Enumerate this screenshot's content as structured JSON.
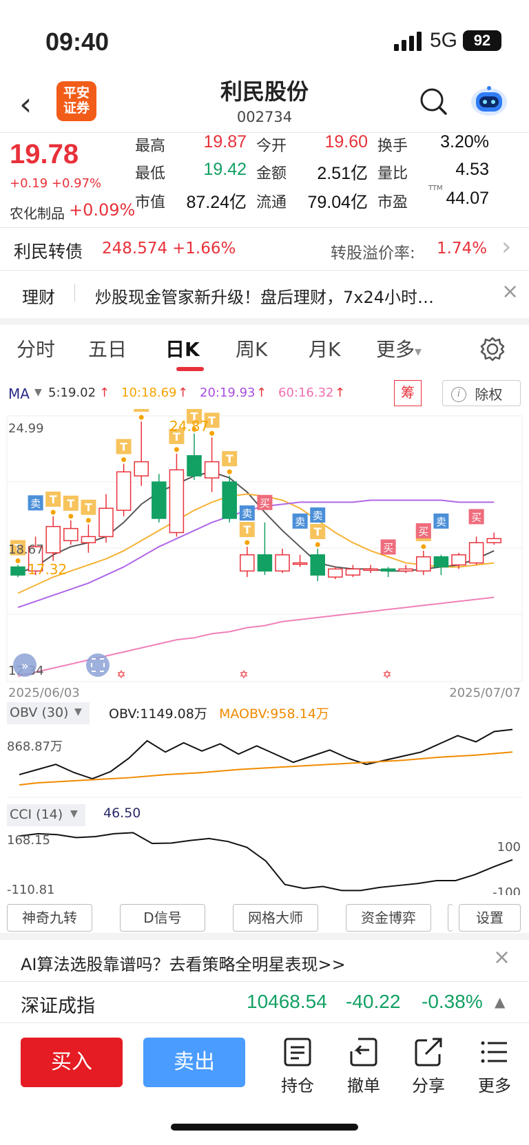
{
  "status_bar": {
    "time": "09:40",
    "network": "5G",
    "battery": "92"
  },
  "header": {
    "logo_line1": "平安",
    "logo_line2": "证券",
    "stock_name": "利民股份",
    "stock_code": "002734"
  },
  "quote": {
    "price": "19.78",
    "change": "+0.19 +0.97%",
    "sector_name": "农化制品",
    "sector_change": "+0.09%",
    "stats": [
      {
        "label": "最高",
        "value": "19.87",
        "color": "red"
      },
      {
        "label": "今开",
        "value": "19.60",
        "color": "red"
      },
      {
        "label": "换手",
        "value": "3.20%",
        "color": "black"
      },
      {
        "label": "最低",
        "value": "19.42",
        "color": "green"
      },
      {
        "label": "金额",
        "value": "2.51亿",
        "color": "black"
      },
      {
        "label": "量比",
        "value": "4.53",
        "color": "black"
      },
      {
        "label": "市值",
        "value": "87.24亿",
        "color": "black"
      },
      {
        "label": "流通",
        "value": "79.04亿",
        "color": "black"
      },
      {
        "label": "市盈",
        "value": "44.07",
        "color": "black",
        "sup": "TTM"
      }
    ]
  },
  "bond": {
    "name": "利民转债",
    "price": "248.574",
    "change": "+1.66%",
    "premium_label": "转股溢价率:",
    "premium_value": "1.74%"
  },
  "finance_banner": {
    "tag": "理财",
    "text": "炒股现金管家新升级！盘后理财，7x24小时…"
  },
  "tabs": [
    "分时",
    "五日",
    "日K",
    "周K",
    "月K",
    "更多"
  ],
  "active_tab": "日K",
  "ma_legend": {
    "label": "MA",
    "ma5": "5:19.02",
    "ma10": "10:18.69",
    "ma20": "20:19.93",
    "ma60": "60:16.32",
    "chips_button": "筹",
    "exright_button": "除权"
  },
  "colors": {
    "up": "#e8313a",
    "down": "#12a063",
    "ma5": "#555555",
    "ma10": "#f5b335",
    "ma20": "#b066e6",
    "ma60": "#f080b8"
  },
  "chart_data": [
    {
      "type": "candlestick",
      "title": "日K",
      "y_axis_labels": {
        "max": "24.99",
        "mid": "18.67",
        "min": "12.34"
      },
      "x_axis_labels": {
        "start": "2025/06/03",
        "end": "2025/07/07"
      },
      "annotations": {
        "high_label": "24.87",
        "low_label": "17.32"
      },
      "candles": [
        {
          "o": 17.8,
          "c": 17.4,
          "h": 17.9,
          "l": 17.3
        },
        {
          "o": 17.6,
          "c": 18.8,
          "h": 19.3,
          "l": 17.4
        },
        {
          "o": 18.5,
          "c": 19.8,
          "h": 20.3,
          "l": 18.1
        },
        {
          "o": 19.1,
          "c": 19.7,
          "h": 20.1,
          "l": 18.9
        },
        {
          "o": 19.0,
          "c": 19.3,
          "h": 19.9,
          "l": 18.5
        },
        {
          "o": 19.3,
          "c": 20.7,
          "h": 21.4,
          "l": 19.0
        },
        {
          "o": 20.6,
          "c": 22.5,
          "h": 22.9,
          "l": 20.3
        },
        {
          "o": 22.3,
          "c": 23.0,
          "h": 24.99,
          "l": 21.8
        },
        {
          "o": 22.0,
          "c": 20.2,
          "h": 22.4,
          "l": 20.0
        },
        {
          "o": 19.5,
          "c": 22.6,
          "h": 23.4,
          "l": 19.3
        },
        {
          "o": 23.3,
          "c": 22.3,
          "h": 24.4,
          "l": 22.1
        },
        {
          "o": 22.2,
          "c": 23.0,
          "h": 24.2,
          "l": 21.5
        },
        {
          "o": 22.0,
          "c": 20.2,
          "h": 22.3,
          "l": 20.0
        },
        {
          "o": 17.6,
          "c": 18.4,
          "h": 18.8,
          "l": 17.3
        },
        {
          "o": 18.4,
          "c": 17.6,
          "h": 20.0,
          "l": 17.4
        },
        {
          "o": 17.6,
          "c": 18.4,
          "h": 18.7,
          "l": 17.5
        },
        {
          "o": 18.0,
          "c": 18.0,
          "h": 18.4,
          "l": 17.8
        },
        {
          "o": 18.4,
          "c": 17.4,
          "h": 18.7,
          "l": 17.1
        },
        {
          "o": 17.3,
          "c": 17.7,
          "h": 17.8,
          "l": 17.2
        },
        {
          "o": 17.4,
          "c": 17.7,
          "h": 17.9,
          "l": 17.3
        },
        {
          "o": 17.7,
          "c": 17.7,
          "h": 17.9,
          "l": 17.5
        },
        {
          "o": 17.7,
          "c": 17.6,
          "h": 17.8,
          "l": 17.3
        },
        {
          "o": 17.6,
          "c": 17.7,
          "h": 17.9,
          "l": 17.5
        },
        {
          "o": 17.6,
          "c": 18.3,
          "h": 18.6,
          "l": 17.4
        },
        {
          "o": 18.3,
          "c": 17.8,
          "h": 18.4,
          "l": 17.4
        },
        {
          "o": 17.9,
          "c": 18.4,
          "h": 18.5,
          "l": 17.7
        },
        {
          "o": 18.0,
          "c": 19.0,
          "h": 19.3,
          "l": 17.9
        },
        {
          "o": 19.0,
          "c": 19.2,
          "h": 19.5,
          "l": 18.9
        }
      ],
      "series": [
        {
          "name": "MA5",
          "values": [
            17.5,
            17.8,
            18.4,
            18.8,
            19.0,
            19.3,
            20.0,
            20.9,
            21.5,
            21.9,
            22.3,
            22.5,
            22.2,
            21.5,
            20.5,
            19.6,
            18.8,
            18.0,
            17.8,
            17.7,
            17.7,
            17.6,
            17.6,
            17.7,
            17.8,
            17.9,
            18.2,
            18.6
          ]
        },
        {
          "name": "MA10",
          "values": [
            16.5,
            16.9,
            17.3,
            17.6,
            17.9,
            18.2,
            18.6,
            19.1,
            19.6,
            20.1,
            20.6,
            21.0,
            21.3,
            21.4,
            21.3,
            21.1,
            20.7,
            20.1,
            19.5,
            19.0,
            18.6,
            18.3,
            18.0,
            17.9,
            17.8,
            17.8,
            17.9,
            18.0
          ]
        },
        {
          "name": "MA20",
          "values": [
            15.8,
            16.1,
            16.4,
            16.7,
            17.0,
            17.4,
            17.8,
            18.3,
            18.8,
            19.2,
            19.6,
            20.0,
            20.3,
            20.6,
            20.8,
            20.9,
            21.0,
            21.0,
            21.0,
            21.0,
            21.1,
            21.1,
            21.1,
            21.1,
            21.1,
            21.0,
            21.0,
            21.0
          ]
        },
        {
          "name": "MA60",
          "values": [
            12.4,
            12.6,
            12.8,
            13.0,
            13.2,
            13.4,
            13.6,
            13.8,
            14.0,
            14.2,
            14.3,
            14.5,
            14.6,
            14.8,
            14.9,
            15.1,
            15.2,
            15.3,
            15.4,
            15.5,
            15.6,
            15.7,
            15.8,
            15.9,
            16.0,
            16.1,
            16.2,
            16.3
          ]
        }
      ]
    },
    {
      "type": "line",
      "title": "OBV",
      "indicator_label": "OBV (30)",
      "legend": {
        "obv": "OBV:1149.08万",
        "maobv": "MAOBV:958.14万"
      },
      "y_label": "868.87万",
      "series": [
        {
          "name": "OBV",
          "values": [
            1,
            1.5,
            2,
            1.2,
            0.6,
            1.3,
            2.6,
            4.3,
            3.2,
            4.1,
            3.3,
            4.0,
            3.0,
            3.8,
            3.0,
            2.2,
            2.8,
            3.4,
            2.6,
            2.0,
            2.4,
            2.8,
            3.2,
            4.0,
            4.8,
            4.2,
            5.2,
            5.4
          ]
        },
        {
          "name": "MAOBV",
          "values": [
            0,
            0.2,
            0.3,
            0.4,
            0.5,
            0.6,
            0.7,
            0.85,
            1.0,
            1.1,
            1.2,
            1.35,
            1.5,
            1.6,
            1.7,
            1.8,
            1.9,
            2.0,
            2.1,
            2.2,
            2.3,
            2.4,
            2.55,
            2.7,
            2.8,
            2.9,
            3.05,
            3.2
          ]
        }
      ]
    },
    {
      "type": "line",
      "title": "CCI",
      "indicator_label": "CCI (14)",
      "legend": {
        "cci": "46.50"
      },
      "y_labels": {
        "top": "168.15",
        "bottom": "-110.81",
        "right_top": "100",
        "right_bottom": "-100"
      },
      "series": [
        {
          "name": "CCI",
          "values": [
            168.15,
            180,
            175,
            160,
            165,
            180,
            185,
            130,
            132,
            145,
            155,
            140,
            110,
            40,
            -80,
            -100,
            -90,
            -110.81,
            -110.81,
            -95,
            -85,
            -75,
            -60,
            -60,
            -30,
            10,
            46.5
          ]
        }
      ]
    }
  ],
  "tools": [
    "神奇九转",
    "D信号",
    "网格大师",
    "资金博弈",
    "设置"
  ],
  "ai_banner": "AI算法选股靠谱吗？去看策略全明星表现>>",
  "index_row": {
    "name": "深证成指",
    "value": "10468.54",
    "change": "-40.22",
    "pct": "-0.38%"
  },
  "bottom_bar": {
    "buy": "买入",
    "sell": "卖出",
    "holdings": "持仓",
    "cancel": "撤单",
    "share": "分享",
    "more": "更多"
  }
}
